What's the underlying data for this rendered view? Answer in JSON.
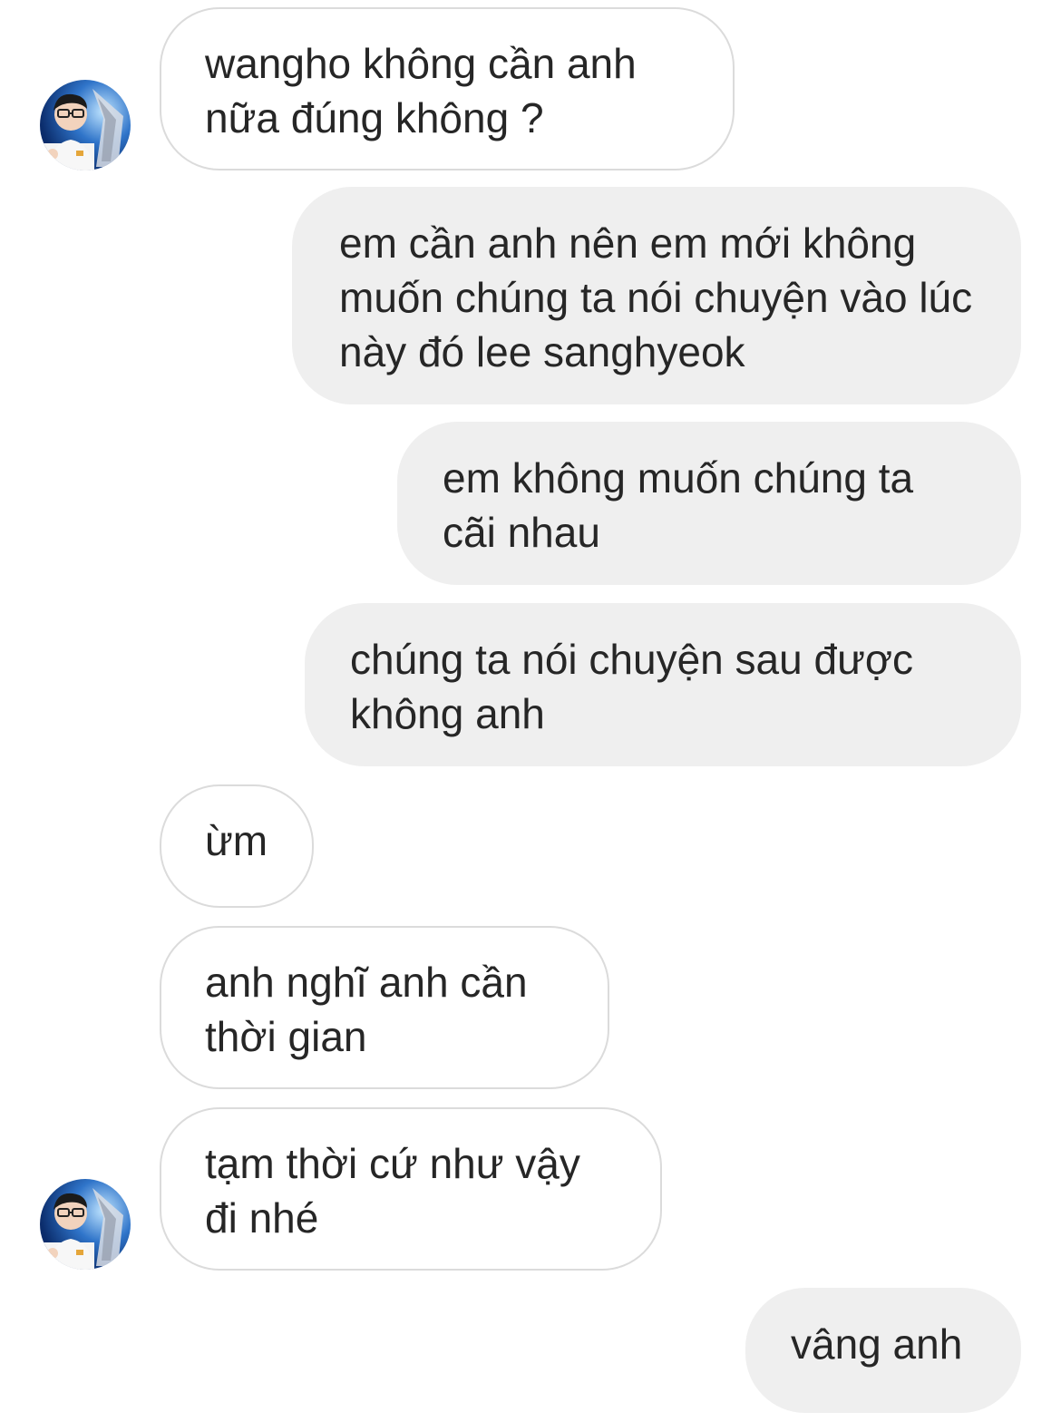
{
  "conversation": {
    "messages": [
      {
        "sender": "contact",
        "text": "wangho không cần anh nữa đúng không ?"
      },
      {
        "sender": "me",
        "text": "em cần anh nên em mới không muốn chúng ta nói chuyện vào lúc này đó lee sanghyeok"
      },
      {
        "sender": "me",
        "text": "em không muốn chúng ta cãi nhau"
      },
      {
        "sender": "me",
        "text": "chúng ta nói chuyện sau được không anh"
      },
      {
        "sender": "contact",
        "text": "ừm"
      },
      {
        "sender": "contact",
        "text": "anh nghĩ anh cần thời gian"
      },
      {
        "sender": "contact",
        "text": "tạm thời cứ như vậy đi nhé"
      },
      {
        "sender": "me",
        "text": "vâng anh"
      }
    ]
  },
  "colors": {
    "sent_bubble": "#efefef",
    "received_border": "#dbdbdb",
    "text": "#262626"
  },
  "icons": {
    "avatar": "contact-profile-photo"
  }
}
